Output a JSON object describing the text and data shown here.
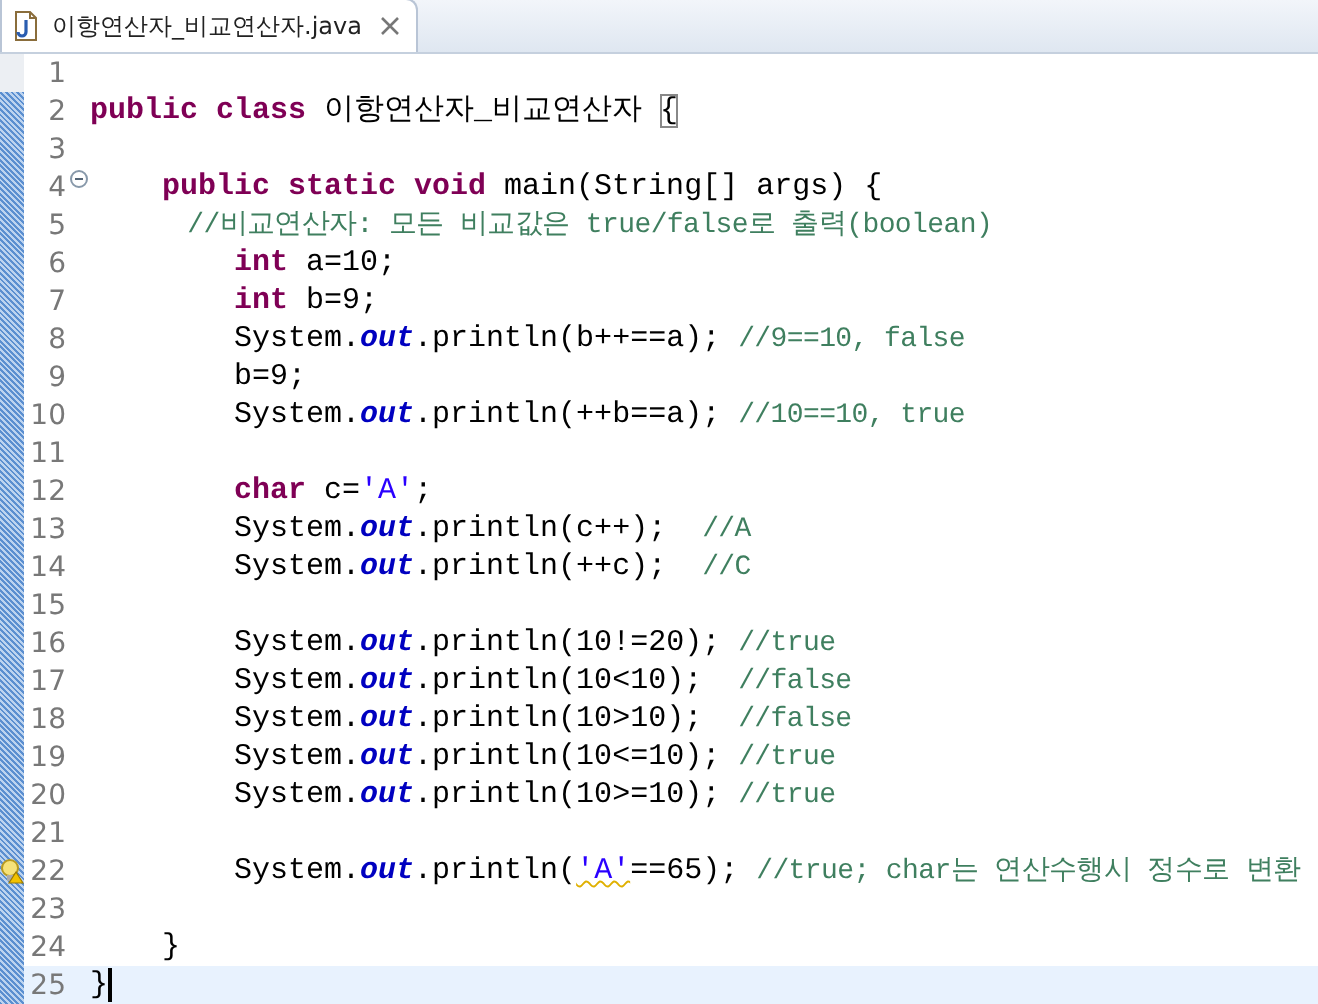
{
  "tab": {
    "title": "이항연산자_비교연산자.java",
    "selected": true
  },
  "lines": [
    {
      "number": "1"
    },
    {
      "number": "2",
      "tokens": [
        {
          "kind": "keyword",
          "text": "public class"
        },
        {
          "kind": "plain",
          "text": " 이항연산자_비교연산자 "
        },
        {
          "kind": "bracket",
          "text": "{"
        }
      ]
    },
    {
      "number": "3"
    },
    {
      "number": "4",
      "fold": true,
      "tokens": [
        {
          "kind": "keyword",
          "text": "    public static void"
        },
        {
          "kind": "plain",
          "text": " main(String[] args) {"
        }
      ]
    },
    {
      "number": "5",
      "tokens": [
        {
          "kind": "comment",
          "text": "      //비교연산자: 모든 비교값은 true/false로 출력(boolean)"
        }
      ]
    },
    {
      "number": "6",
      "tokens": [
        {
          "kind": "keyword",
          "text": "        int"
        },
        {
          "kind": "plain",
          "text": " a=10;"
        }
      ]
    },
    {
      "number": "7",
      "tokens": [
        {
          "kind": "keyword",
          "text": "        int"
        },
        {
          "kind": "plain",
          "text": " b=9;"
        }
      ]
    },
    {
      "number": "8",
      "tokens": [
        {
          "kind": "plain",
          "text": "        System."
        },
        {
          "kind": "field",
          "text": "out"
        },
        {
          "kind": "plain",
          "text": ".println(b++==a); "
        },
        {
          "kind": "comment",
          "text": "//9==10, false"
        }
      ]
    },
    {
      "number": "9",
      "tokens": [
        {
          "kind": "plain",
          "text": "        b=9;"
        }
      ]
    },
    {
      "number": "10",
      "tokens": [
        {
          "kind": "plain",
          "text": "        System."
        },
        {
          "kind": "field",
          "text": "out"
        },
        {
          "kind": "plain",
          "text": ".println(++b==a); "
        },
        {
          "kind": "comment",
          "text": "//10==10, true"
        }
      ]
    },
    {
      "number": "11"
    },
    {
      "number": "12",
      "tokens": [
        {
          "kind": "keyword",
          "text": "        char"
        },
        {
          "kind": "plain",
          "text": " c="
        },
        {
          "kind": "string",
          "text": "'A'"
        },
        {
          "kind": "plain",
          "text": ";"
        }
      ]
    },
    {
      "number": "13",
      "tokens": [
        {
          "kind": "plain",
          "text": "        System."
        },
        {
          "kind": "field",
          "text": "out"
        },
        {
          "kind": "plain",
          "text": ".println(c++);  "
        },
        {
          "kind": "comment",
          "text": "//A"
        }
      ]
    },
    {
      "number": "14",
      "tokens": [
        {
          "kind": "plain",
          "text": "        System."
        },
        {
          "kind": "field",
          "text": "out"
        },
        {
          "kind": "plain",
          "text": ".println(++c);  "
        },
        {
          "kind": "comment",
          "text": "//C"
        }
      ]
    },
    {
      "number": "15"
    },
    {
      "number": "16",
      "tokens": [
        {
          "kind": "plain",
          "text": "        System."
        },
        {
          "kind": "field",
          "text": "out"
        },
        {
          "kind": "plain",
          "text": ".println(10!=20); "
        },
        {
          "kind": "comment",
          "text": "//true"
        }
      ]
    },
    {
      "number": "17",
      "tokens": [
        {
          "kind": "plain",
          "text": "        System."
        },
        {
          "kind": "field",
          "text": "out"
        },
        {
          "kind": "plain",
          "text": ".println(10<10);  "
        },
        {
          "kind": "comment",
          "text": "//false"
        }
      ]
    },
    {
      "number": "18",
      "tokens": [
        {
          "kind": "plain",
          "text": "        System."
        },
        {
          "kind": "field",
          "text": "out"
        },
        {
          "kind": "plain",
          "text": ".println(10>10);  "
        },
        {
          "kind": "comment",
          "text": "//false"
        }
      ]
    },
    {
      "number": "19",
      "tokens": [
        {
          "kind": "plain",
          "text": "        System."
        },
        {
          "kind": "field",
          "text": "out"
        },
        {
          "kind": "plain",
          "text": ".println(10<=10); "
        },
        {
          "kind": "comment",
          "text": "//true"
        }
      ]
    },
    {
      "number": "20",
      "tokens": [
        {
          "kind": "plain",
          "text": "        System."
        },
        {
          "kind": "field",
          "text": "out"
        },
        {
          "kind": "plain",
          "text": ".println(10>=10); "
        },
        {
          "kind": "comment",
          "text": "//true"
        }
      ]
    },
    {
      "number": "21"
    },
    {
      "number": "22",
      "warning": true,
      "tokens": [
        {
          "kind": "plain",
          "text": "        System."
        },
        {
          "kind": "field",
          "text": "out"
        },
        {
          "kind": "plain",
          "text": ".println("
        },
        {
          "kind": "warned-string",
          "text": "'A'"
        },
        {
          "kind": "plain",
          "text": "==65); "
        },
        {
          "kind": "comment",
          "text": "//true; char는 연산수행시 정수로 변환"
        }
      ]
    },
    {
      "number": "23"
    },
    {
      "number": "24",
      "tokens": [
        {
          "kind": "plain",
          "text": "    }"
        }
      ]
    },
    {
      "number": "25",
      "current": true,
      "tokens": [
        {
          "kind": "plain",
          "text": "}"
        }
      ]
    }
  ]
}
